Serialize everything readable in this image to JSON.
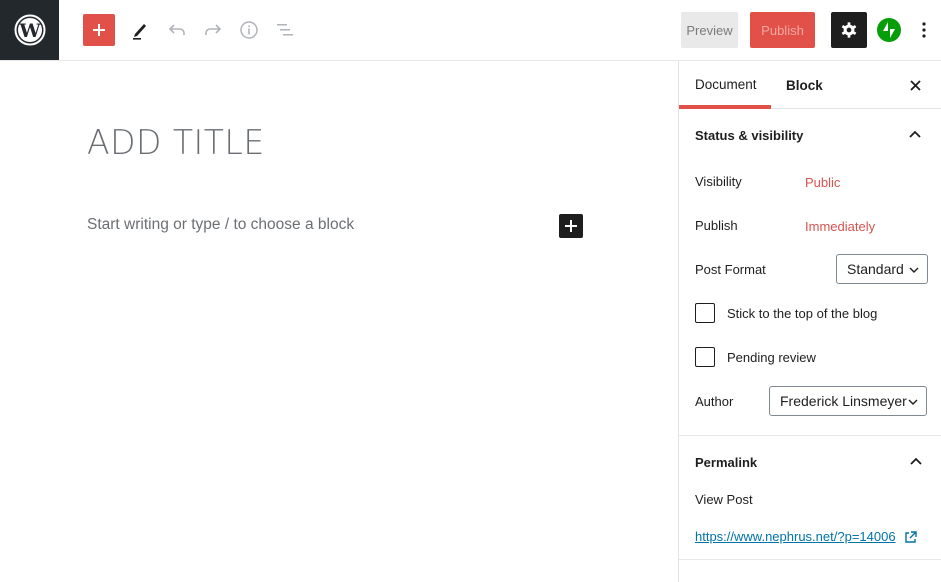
{
  "toolbar": {
    "logo": "wordpress-logo",
    "inserter_icon": "plus-icon",
    "tools_icon": "pencil-icon",
    "undo_icon": "undo-icon",
    "redo_icon": "redo-icon",
    "info_icon": "info-icon",
    "outline_icon": "list-view-icon",
    "preview_label": "Preview",
    "publish_label": "Publish",
    "settings_icon": "gear-icon",
    "jetpack_icon": "jetpack-icon",
    "more_icon": "more-vertical-icon"
  },
  "editor": {
    "title_placeholder": "ADD TITLE",
    "body_placeholder": "Start writing or type / to choose a block"
  },
  "sidebar": {
    "tabs": [
      {
        "label": "Document",
        "active": true
      },
      {
        "label": "Block",
        "active": false
      }
    ],
    "status_panel": {
      "title": "Status & visibility",
      "visibility_label": "Visibility",
      "visibility_value": "Public",
      "publish_label": "Publish",
      "publish_value": "Immediately",
      "post_format_label": "Post Format",
      "post_format_value": "Standard",
      "sticky_label": "Stick to the top of the blog",
      "sticky_checked": false,
      "pending_label": "Pending review",
      "pending_checked": false,
      "author_label": "Author",
      "author_value": "Frederick Linsmeyer"
    },
    "permalink_panel": {
      "title": "Permalink",
      "view_post_label": "View Post",
      "url": "https://www.nephrus.net/?p=14006"
    }
  },
  "colors": {
    "accent": "#e2504a",
    "link": "#0073aa",
    "dark": "#1e1e1e",
    "logo_bg": "#23282d",
    "jetpack": "#069e08"
  }
}
